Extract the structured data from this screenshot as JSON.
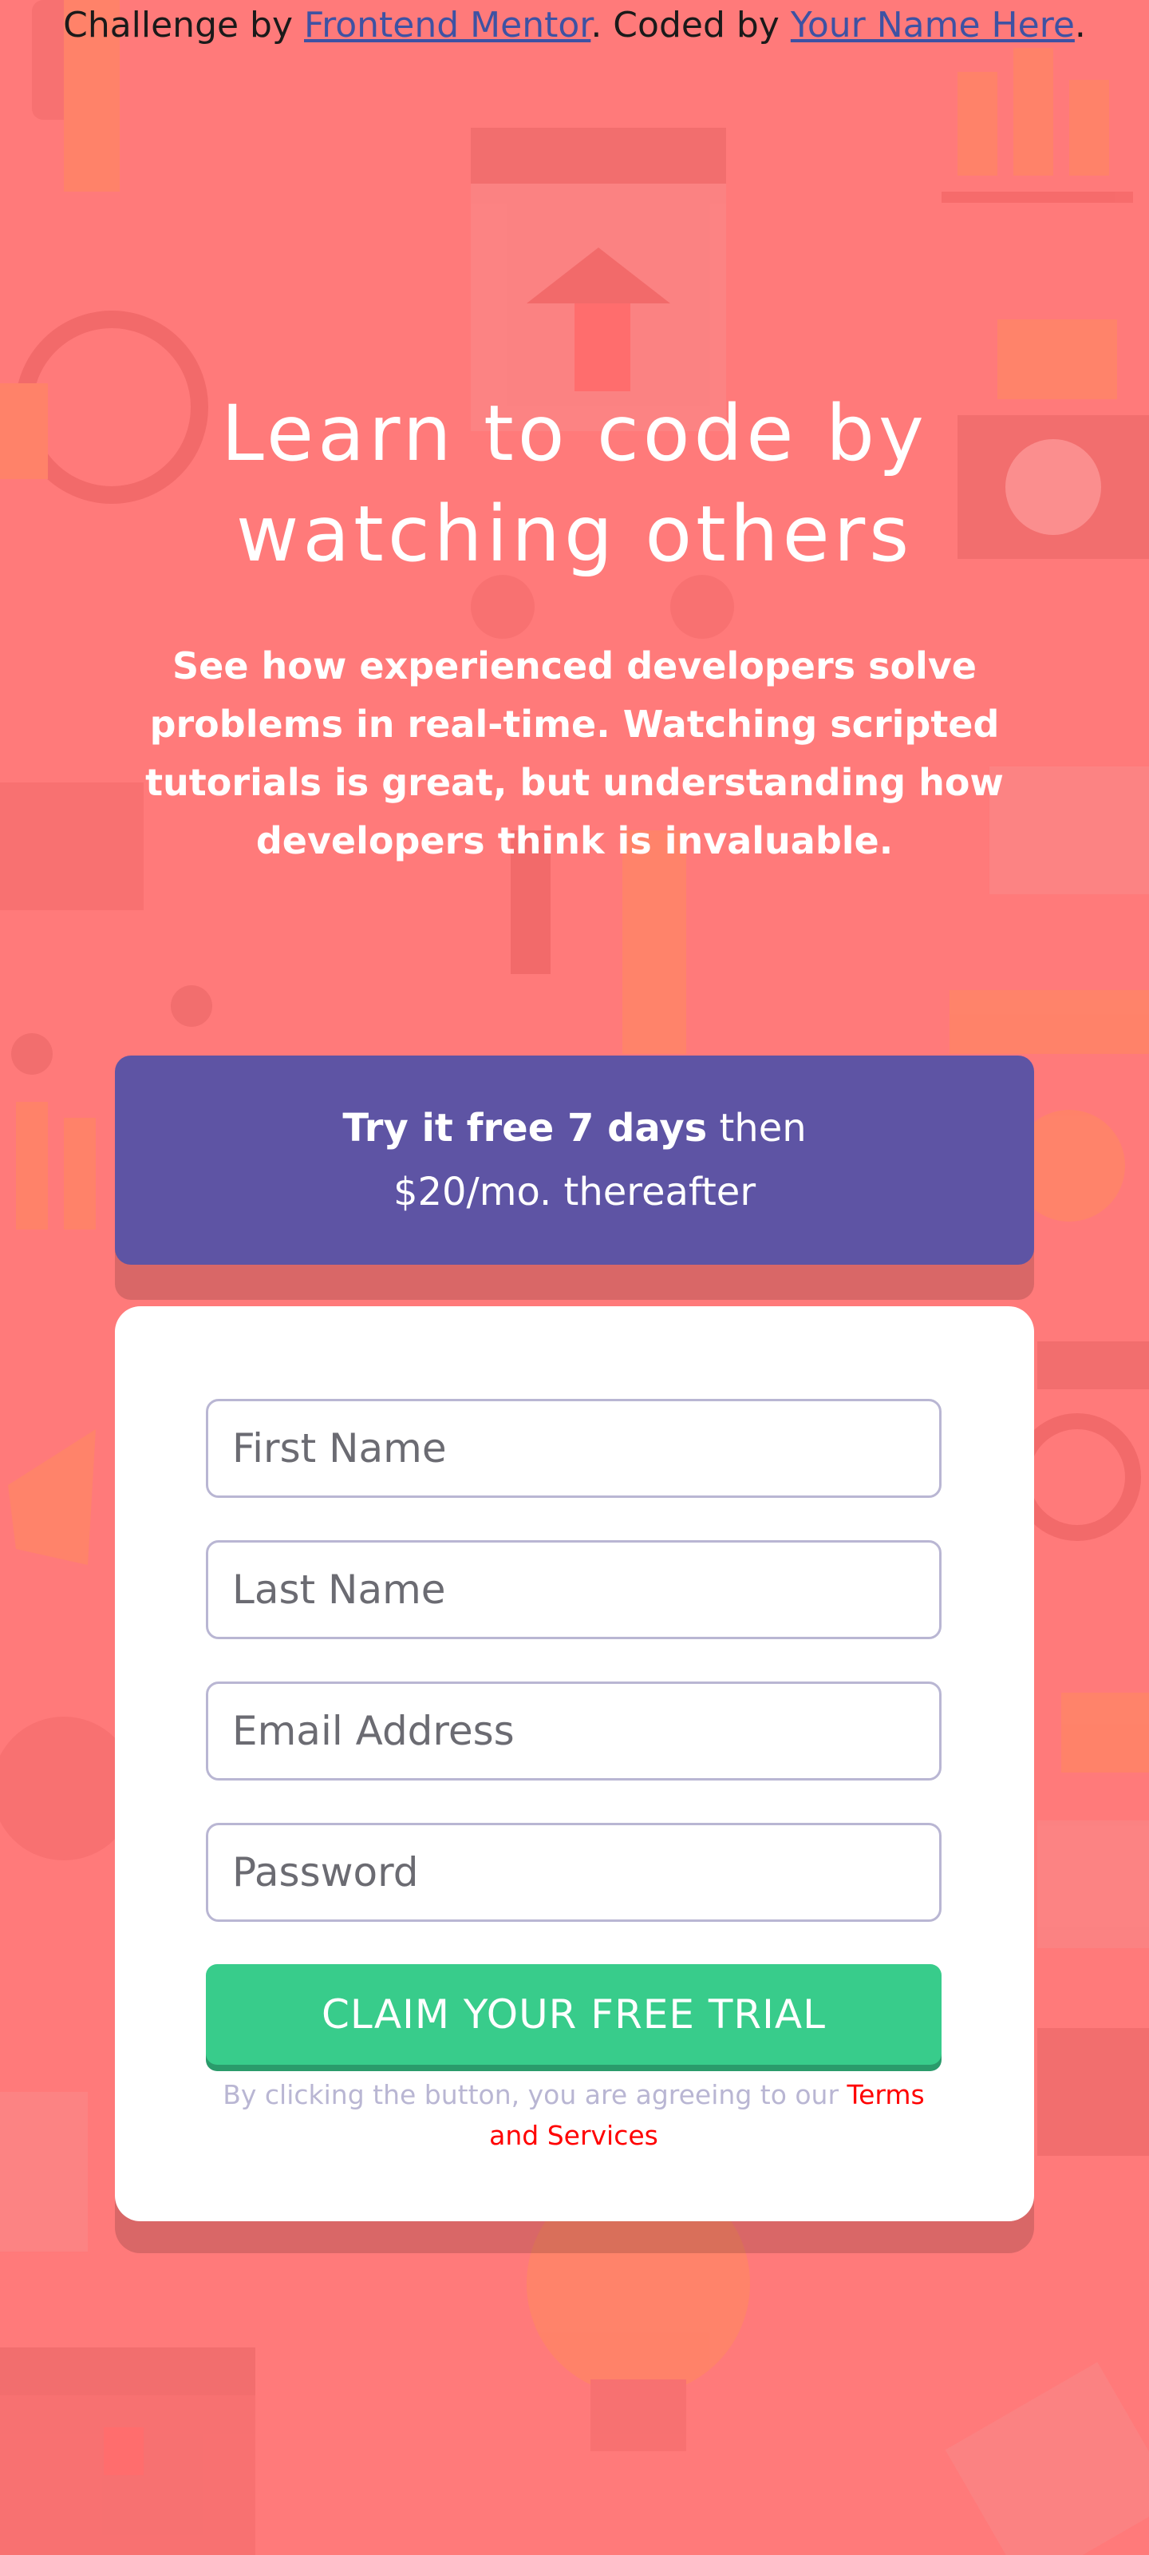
{
  "attribution": {
    "prefix": "Challenge by ",
    "link1": "Frontend Mentor",
    "middle": ". Coded by ",
    "link2": "Your Name Here",
    "suffix": "."
  },
  "hero": {
    "title": "Learn to code by watching others",
    "description": "See how experienced developers solve problems in real-time. Watching scripted tutorials is great, but understanding how developers think is invaluable."
  },
  "offer": {
    "bold_text": "Try it free 7 days",
    "rest_line1": " then",
    "line2": "$20/mo. thereafter"
  },
  "form": {
    "first_name_placeholder": "First Name",
    "last_name_placeholder": "Last Name",
    "email_placeholder": "Email Address",
    "password_placeholder": "Password",
    "submit_label": "CLAIM YOUR FREE TRIAL",
    "terms_prefix": "By clicking the button, you are agreeing to our ",
    "terms_link": "Terms and Services"
  },
  "colors": {
    "background": "#ff7a7a",
    "offer_bg": "#5e54a4",
    "cta": "#38cc8b",
    "terms_link": "#ff0000"
  }
}
